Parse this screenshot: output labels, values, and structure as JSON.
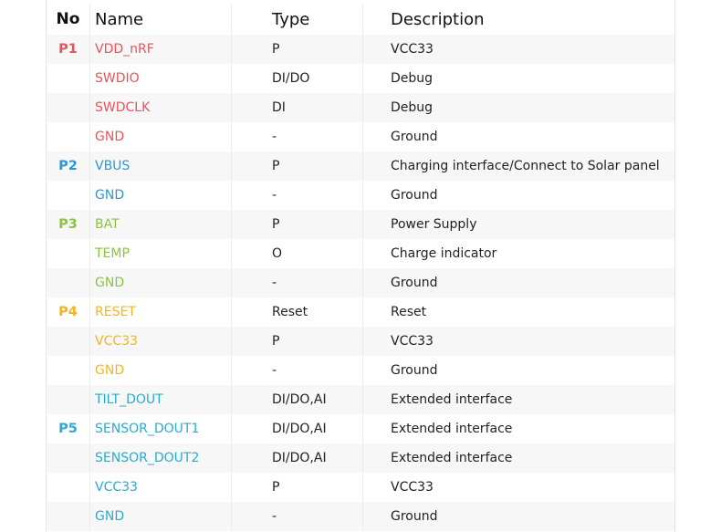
{
  "colors": {
    "P1": "#e8535b",
    "P2": "#2b98d3",
    "P3": "#8ac43f",
    "P4": "#f2b522",
    "P5": "#2ba9d3"
  },
  "headers": {
    "no": "No",
    "name": "Name",
    "type": "Type",
    "description": "Description"
  },
  "rows": [
    {
      "no": "P1",
      "group": "P1",
      "name": "VDD_nRF",
      "type": "P",
      "description": "VCC33"
    },
    {
      "no": "",
      "group": "P1",
      "name": "SWDIO",
      "type": "DI/DO",
      "description": "Debug"
    },
    {
      "no": "",
      "group": "P1",
      "name": "SWDCLK",
      "type": "DI",
      "description": "Debug"
    },
    {
      "no": "",
      "group": "P1",
      "name": "GND",
      "type": "-",
      "description": "Ground"
    },
    {
      "no": "P2",
      "group": "P2",
      "name": "VBUS",
      "type": "P",
      "description": "Charging interface/Connect to Solar panel"
    },
    {
      "no": "",
      "group": "P2",
      "name": "GND",
      "type": "-",
      "description": "Ground"
    },
    {
      "no": "P3",
      "group": "P3",
      "name": "BAT",
      "type": "P",
      "description": "Power Supply"
    },
    {
      "no": "",
      "group": "P3",
      "name": "TEMP",
      "type": "O",
      "description": "Charge indicator"
    },
    {
      "no": "",
      "group": "P3",
      "name": "GND",
      "type": "-",
      "description": "Ground"
    },
    {
      "no": "P4",
      "group": "P4",
      "name": "RESET",
      "type": "Reset",
      "description": "Reset"
    },
    {
      "no": "",
      "group": "P4",
      "name": "VCC33",
      "type": "P",
      "description": "VCC33"
    },
    {
      "no": "",
      "group": "P4",
      "name": "GND",
      "type": "-",
      "description": "Ground"
    },
    {
      "no": "",
      "group": "P5",
      "name": "TILT_DOUT",
      "type": "DI/DO,AI",
      "description": "Extended interface"
    },
    {
      "no": "P5",
      "group": "P5",
      "name": "SENSOR_DOUT1",
      "type": "DI/DO,AI",
      "description": "Extended interface"
    },
    {
      "no": "",
      "group": "P5",
      "name": "SENSOR_DOUT2",
      "type": "DI/DO,AI",
      "description": "Extended interface"
    },
    {
      "no": "",
      "group": "P5",
      "name": "VCC33",
      "type": "P",
      "description": "VCC33"
    },
    {
      "no": "",
      "group": "P5",
      "name": "GND",
      "type": "-",
      "description": "Ground"
    }
  ]
}
